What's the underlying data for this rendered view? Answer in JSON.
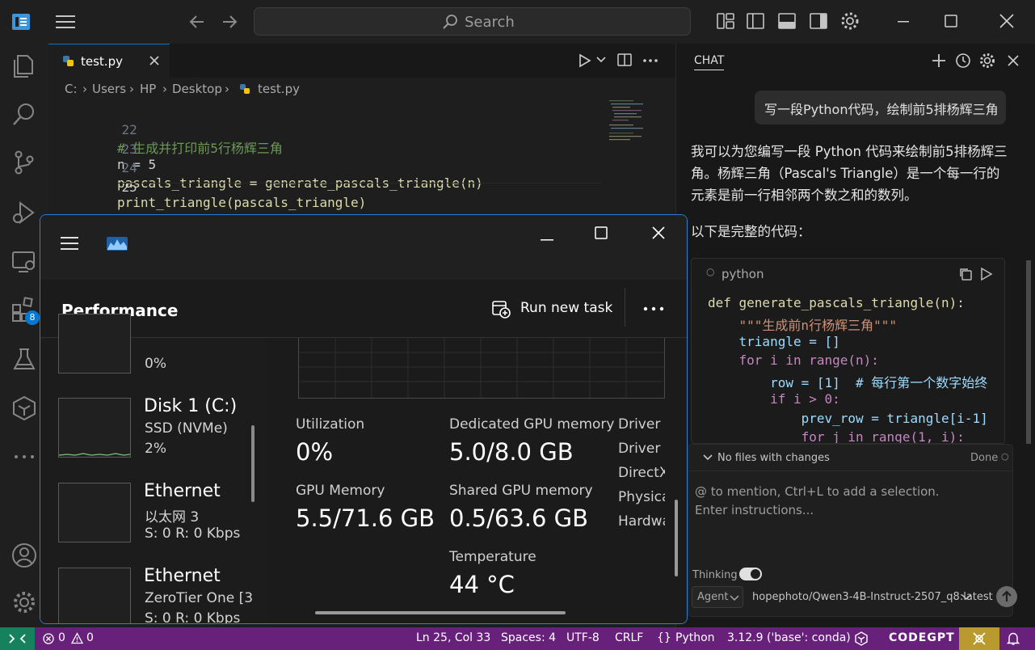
{
  "titlebar": {
    "search_placeholder": "Search"
  },
  "activity_bar": {
    "extensions_badge": "8"
  },
  "editor": {
    "tab_label": "test.py",
    "breadcrumb": [
      "C:",
      "Users",
      "HP",
      "Desktop",
      "test.py"
    ],
    "lines": [
      {
        "num": "22",
        "text": "# 生成并打印前5行杨辉三角"
      },
      {
        "num": "23",
        "text": "n = 5"
      },
      {
        "num": "24",
        "text": "pascals_triangle = generate_pascals_triangle(n)"
      },
      {
        "num": "25",
        "text": "print_triangle(pascals_triangle)"
      }
    ]
  },
  "chat": {
    "title": "CHAT",
    "user_message": "写一段Python代码，绘制前5排杨辉三角",
    "reply_paragraph": "我可以为您编写一段 Python 代码来绘制前5排杨辉三角。杨辉三角（Pascal's Triangle）是一个每一行的元素是前一行相邻两个数之和的数列。",
    "reply_intro": "以下是完整的代码：",
    "code_lang": "python",
    "code_lines": [
      "def generate_pascals_triangle(n):",
      "    \"\"\"生成前n行杨辉三角\"\"\"",
      "    triangle = []",
      "    for i in range(n):",
      "        row = [1]  # 每行第一个数字始终",
      "        if i > 0:",
      "            prev_row = triangle[i-1]",
      "            for j in range(1, i):"
    ],
    "changes_label": "No files with changes",
    "done_label": "Done",
    "input_placeholder": "@ to mention, Ctrl+L to add a selection. Enter instructions...",
    "thinking_label": "Thinking",
    "agent_label": "Agent",
    "model_label": "hopephoto/Qwen3-4B-Instruct-2507_q8:latest"
  },
  "taskmgr": {
    "page_title": "Performance",
    "run_task_label": "Run new task",
    "devices": [
      {
        "title": "",
        "sub1": "0%",
        "sub2": ""
      },
      {
        "title": "Disk 1 (C:)",
        "sub1": "SSD (NVMe)",
        "sub2": "2%"
      },
      {
        "title": "Ethernet",
        "sub1": "以太网 3",
        "sub2": "S: 0  R: 0 Kbps"
      },
      {
        "title": "Ethernet",
        "sub1": "ZeroTier One [3",
        "sub2": "S: 0  R: 0 Kbps"
      }
    ],
    "stats": {
      "utilization_label": "Utilization",
      "utilization_value": "0%",
      "dedicated_label": "Dedicated GPU memory",
      "dedicated_value": "5.0/8.0 GB",
      "gpu_mem_label": "GPU Memory",
      "gpu_mem_value": "5.5/71.6 GB",
      "shared_label": "Shared GPU memory",
      "shared_value": "0.5/63.6 GB",
      "temp_label": "Temperature",
      "temp_value": "44 °C"
    },
    "driver_labels": [
      "Driver v",
      "Driver d",
      "DirectX",
      "Physica",
      "Hardwa"
    ]
  },
  "statusbar": {
    "errors": "0",
    "warnings": "0",
    "position": "Ln 25, Col 33",
    "spaces": "Spaces: 4",
    "encoding": "UTF-8",
    "eol": "CRLF",
    "language": "Python",
    "interpreter": "3.12.9 ('base': conda)",
    "codegpt": "CODEGPT"
  },
  "colors": {
    "accent": "#0078d4",
    "statusbar": "#68217a",
    "taskmgr_border": "#2b7fd6"
  }
}
